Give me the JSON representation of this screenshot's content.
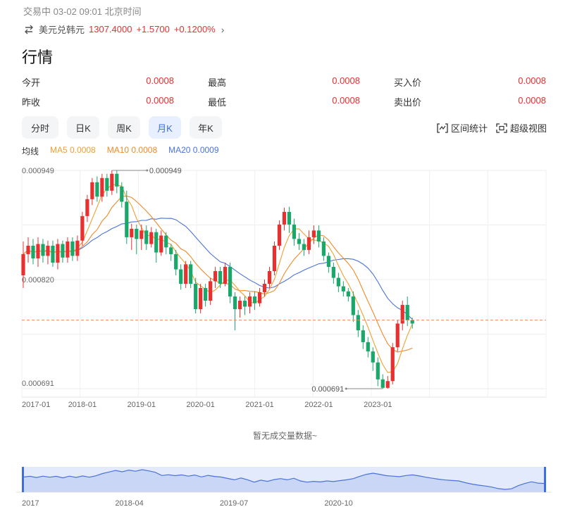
{
  "header": {
    "status": "交易中 03-02 09:01 北京时间",
    "pair_name": "美元兑韩元",
    "price": "1307.4000",
    "change": "+1.5700",
    "change_pct": "+0.1200%",
    "swap_icon": "swap-arrows-icon",
    "chevron_icon": "chevron-right-icon"
  },
  "section_title": "行情",
  "quote": {
    "rows": [
      [
        {
          "label": "今开",
          "value": "0.0008"
        },
        {
          "label": "最高",
          "value": "0.0008"
        },
        {
          "label": "买入价",
          "value": "0.0008"
        }
      ],
      [
        {
          "label": "昨收",
          "value": "0.0008"
        },
        {
          "label": "最低",
          "value": "0.0008"
        },
        {
          "label": "卖出价",
          "value": "0.0008"
        }
      ]
    ]
  },
  "tabs": [
    {
      "label": "分时",
      "active": false
    },
    {
      "label": "日K",
      "active": false
    },
    {
      "label": "周K",
      "active": false
    },
    {
      "label": "月K",
      "active": true
    },
    {
      "label": "年K",
      "active": false
    }
  ],
  "tools": {
    "interval_stats": "区间统计",
    "interval_icon": "range-bracket-icon",
    "super_view": "超级视图",
    "super_icon": "fullscreen-icon"
  },
  "ma_legend": {
    "title": "均线",
    "ma5": "MA5 0.0008",
    "ma10": "MA10 0.0008",
    "ma20": "MA20 0.0009"
  },
  "colors": {
    "up": "#e93030",
    "down": "#1aa76a",
    "ma5": "#f0a035",
    "ma10": "#f08a2a",
    "ma20": "#4a72d8",
    "accent": "#3d6fe0"
  },
  "chart_data": {
    "type": "candlestick",
    "y_ticks": [
      "0.000949",
      "0.000820",
      "0.000691"
    ],
    "ylim": [
      0.000691,
      0.000949
    ],
    "x_ticks": [
      "2017-01",
      "2018-01",
      "2019-01",
      "2020-01",
      "2021-01",
      "2022-01",
      "2023-01"
    ],
    "max_label": "0.000949",
    "min_label": "0.000691",
    "last_price": 0.000772,
    "candles": [
      [
        0.000825,
        0.00085,
        0.00081,
        0.000865
      ],
      [
        0.00085,
        0.00086,
        0.00084,
        0.00087
      ],
      [
        0.00086,
        0.000845,
        0.000838,
        0.000868
      ],
      [
        0.000845,
        0.000862,
        0.000835,
        0.00087
      ],
      [
        0.000862,
        0.000848,
        0.00084,
        0.000868
      ],
      [
        0.000848,
        0.00086,
        0.000838,
        0.000866
      ],
      [
        0.00086,
        0.00084,
        0.000835,
        0.000866
      ],
      [
        0.00084,
        0.000862,
        0.000832,
        0.000868
      ],
      [
        0.000862,
        0.000846,
        0.00084,
        0.000866
      ],
      [
        0.000846,
        0.000865,
        0.00084,
        0.00087
      ],
      [
        0.000865,
        0.000848,
        0.000842,
        0.00087
      ],
      [
        0.000848,
        0.000866,
        0.000842,
        0.000872
      ],
      [
        0.000866,
        0.000895,
        0.00086,
        0.0009
      ],
      [
        0.000895,
        0.000915,
        0.000888,
        0.00092
      ],
      [
        0.000915,
        0.000935,
        0.000908,
        0.00094
      ],
      [
        0.000935,
        0.000918,
        0.000912,
        0.000942
      ],
      [
        0.000918,
        0.00094,
        0.000912,
        0.000945
      ],
      [
        0.00094,
        0.000925,
        0.000918,
        0.000945
      ],
      [
        0.000925,
        0.000945,
        0.00092,
        0.000949
      ],
      [
        0.000945,
        0.00093,
        0.000922,
        0.000949
      ],
      [
        0.00093,
        0.000912,
        0.000905,
        0.000935
      ],
      [
        0.000912,
        0.00087,
        0.000862,
        0.000925
      ],
      [
        0.00087,
        0.00088,
        0.000855,
        0.000886
      ],
      [
        0.00088,
        0.000868,
        0.00085,
        0.000885
      ],
      [
        0.000868,
        0.000878,
        0.000855,
        0.000885
      ],
      [
        0.000878,
        0.000862,
        0.000855,
        0.000884
      ],
      [
        0.000862,
        0.000876,
        0.000858,
        0.000882
      ],
      [
        0.000876,
        0.000852,
        0.00084,
        0.00088
      ],
      [
        0.000852,
        0.000872,
        0.000848,
        0.000878
      ],
      [
        0.000872,
        0.000858,
        0.00085,
        0.000876
      ],
      [
        0.000858,
        0.00085,
        0.000842,
        0.000862
      ],
      [
        0.00085,
        0.000832,
        0.000825,
        0.000855
      ],
      [
        0.000832,
        0.000815,
        0.000808,
        0.000838
      ],
      [
        0.000815,
        0.000838,
        0.00081,
        0.000842
      ],
      [
        0.000838,
        0.000815,
        0.00081,
        0.000842
      ],
      [
        0.000815,
        0.000785,
        0.00078,
        0.000822
      ],
      [
        0.000785,
        0.00081,
        0.00078,
        0.000815
      ],
      [
        0.00081,
        0.000795,
        0.000788,
        0.000815
      ],
      [
        0.000795,
        0.000818,
        0.00079,
        0.000822
      ],
      [
        0.000818,
        0.00083,
        0.00081,
        0.000835
      ],
      [
        0.00083,
        0.000815,
        0.00081,
        0.000835
      ],
      [
        0.000815,
        0.000835,
        0.000812,
        0.00084
      ],
      [
        0.000835,
        0.0008,
        0.000792,
        0.00084
      ],
      [
        0.0008,
        0.000785,
        0.00076,
        0.000805
      ],
      [
        0.000785,
        0.000795,
        0.000775,
        0.0008
      ],
      [
        0.000795,
        0.000788,
        0.000778,
        0.0008
      ],
      [
        0.000788,
        0.0008,
        0.00078,
        0.000805
      ],
      [
        0.0008,
        0.000792,
        0.000784,
        0.000806
      ],
      [
        0.000792,
        0.000805,
        0.000788,
        0.00081
      ],
      [
        0.000805,
        0.000815,
        0.0008,
        0.00082
      ],
      [
        0.000815,
        0.00083,
        0.00081,
        0.000835
      ],
      [
        0.00083,
        0.00086,
        0.000825,
        0.000865
      ],
      [
        0.00086,
        0.000885,
        0.000855,
        0.00089
      ],
      [
        0.000885,
        0.0009,
        0.000878,
        0.000905
      ],
      [
        0.0009,
        0.000885,
        0.000875,
        0.000906
      ],
      [
        0.000885,
        0.000868,
        0.00086,
        0.000892
      ],
      [
        0.000868,
        0.000862,
        0.000855,
        0.000875
      ],
      [
        0.000862,
        0.000855,
        0.000848,
        0.000868
      ],
      [
        0.000855,
        0.00087,
        0.00085,
        0.000878
      ],
      [
        0.00087,
        0.000878,
        0.000862,
        0.000884
      ],
      [
        0.000878,
        0.000865,
        0.000858,
        0.000884
      ],
      [
        0.000865,
        0.000848,
        0.000842,
        0.00087
      ],
      [
        0.000848,
        0.000835,
        0.000828,
        0.000852
      ],
      [
        0.000835,
        0.000822,
        0.000815,
        0.00084
      ],
      [
        0.000822,
        0.000812,
        0.000805,
        0.000828
      ],
      [
        0.000812,
        0.000806,
        0.0008,
        0.000818
      ],
      [
        0.000806,
        0.0008,
        0.000794,
        0.00081
      ],
      [
        0.0008,
        0.000778,
        0.00077,
        0.000806
      ],
      [
        0.000778,
        0.00076,
        0.000752,
        0.000784
      ],
      [
        0.00076,
        0.000746,
        0.000738,
        0.000766
      ],
      [
        0.000746,
        0.000735,
        0.000728,
        0.000752
      ],
      [
        0.000735,
        0.000722,
        0.000712,
        0.00074
      ],
      [
        0.000722,
        0.000702,
        0.000694,
        0.000728
      ],
      [
        0.000702,
        0.000692,
        0.000691,
        0.000708
      ],
      [
        0.000692,
        0.0007,
        0.000691,
        0.000706
      ],
      [
        0.0007,
        0.00074,
        0.000696,
        0.000745
      ],
      [
        0.00074,
        0.000768,
        0.000735,
        0.000772
      ],
      [
        0.000768,
        0.00079,
        0.00076,
        0.000795
      ],
      [
        0.00079,
        0.000772,
        0.000765,
        0.0008
      ],
      [
        0.000772,
        0.000768,
        0.000762,
        0.000775
      ]
    ]
  },
  "volume_empty": "暂无成交量数据~",
  "navigator": {
    "labels": [
      "2017",
      "2018-04",
      "2019-07",
      "2020-10"
    ]
  }
}
